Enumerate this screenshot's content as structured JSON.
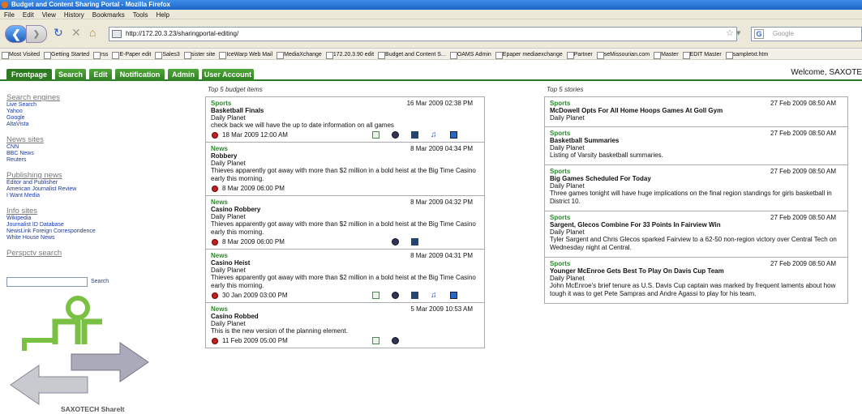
{
  "window": {
    "title": "Budget and Content Sharing Portal - Mozilla Firefox"
  },
  "menu": [
    "File",
    "Edit",
    "View",
    "History",
    "Bookmarks",
    "Tools",
    "Help"
  ],
  "address": {
    "url": "http://172.20.3.23/sharingportal-editing/",
    "search_placeholder": "Google"
  },
  "bookmarks": [
    "Most Visited",
    "Getting Started",
    "rss",
    "E-Paper edit",
    "Sales3",
    "sister site",
    "IceWarp Web Mail",
    "MediaXchange",
    "172.20.3.90 edit",
    "Budget and Content S...",
    "OAMS Admin",
    "Epaper mediaexchange",
    "Partner",
    "seMissourian.com",
    "Master",
    "EDIT Master",
    "sampletxt.htm"
  ],
  "tabs": [
    "Frontpage",
    "Search",
    "Edit",
    "Notification",
    "Admin",
    "User Account"
  ],
  "welcome": "Welcome, SAXOTE",
  "left": {
    "groups": [
      {
        "heading": "Search engines",
        "links": [
          "Live Search",
          "Yahoo",
          "Google",
          "AltaVista"
        ]
      },
      {
        "heading": "News sites",
        "links": [
          "CNN",
          "BBC News",
          "Reuters"
        ]
      },
      {
        "heading": "Publishing news",
        "links": [
          "Editor and Publisher",
          "American Journalist Review",
          "I Want Media"
        ]
      },
      {
        "heading": "Info sites",
        "links": [
          "Wikipedia",
          "Journalist ID Database",
          "NewsLink Foreign Correspondence",
          "White House News"
        ]
      }
    ],
    "search_heading": "Perspctv search",
    "search_button": "Search",
    "logo_text": "SAXOTECH ShareIt"
  },
  "budget": {
    "title": "Top 5 budget items",
    "items": [
      {
        "category": "Sports",
        "timestamp": "16 Mar 2009 02:38 PM",
        "title": "Basketball Finals",
        "source": "Daily Planet",
        "desc": "check back we will have the up to date information on all games",
        "deadline": "18 Mar 2009 12:00 AM",
        "icons": [
          "doc-icon",
          "record-icon",
          "video-icon",
          "audio-icon",
          "image-icon"
        ]
      },
      {
        "category": "News",
        "timestamp": "8 Mar 2009 04:34 PM",
        "title": "Robbery",
        "source": "Daily Planet",
        "desc": "Thieves apparently got away with more than $2 million in a bold heist at the Big Time Casino early this morning.",
        "deadline": "8 Mar 2009 06:00 PM",
        "icons": []
      },
      {
        "category": "News",
        "timestamp": "8 Mar 2009 04:32 PM",
        "title": "Casino Robbery",
        "source": "Daily Planet",
        "desc": "Thieves apparently got away with more than $2 million in a bold heist at the Big Time Casino early this morning.",
        "deadline": "8 Mar 2009 06:00 PM",
        "icons": [
          "record-icon",
          "video-icon"
        ]
      },
      {
        "category": "News",
        "timestamp": "8 Mar 2009 04:31 PM",
        "title": "Casino Heist",
        "source": "Daily Planet",
        "desc": "Thieves apparently got away with more than $2 million in a bold heist at the Big Time Casino early this morning.",
        "deadline": "30 Jan 2009 03:00 PM",
        "icons": [
          "doc-icon",
          "record-icon",
          "video-icon",
          "audio-icon",
          "image-icon"
        ]
      },
      {
        "category": "News",
        "timestamp": "5 Mar 2009 10:53 AM",
        "title": "Casino Robbed",
        "source": "Daily Planet",
        "desc": "This is the new version of the planning element.",
        "deadline": "11 Feb 2009 05:00 PM",
        "icons": [
          "doc-icon",
          "record-icon"
        ]
      }
    ]
  },
  "stories": {
    "title": "Top 5 stories",
    "items": [
      {
        "category": "Sports",
        "timestamp": "27 Feb 2009 08:50 AM",
        "title": "McDowell Opts For All Home Hoops Games At Goll Gym",
        "source": "Daily Planet",
        "desc": ""
      },
      {
        "category": "Sports",
        "timestamp": "27 Feb 2009 08:50 AM",
        "title": "Basketball Summaries",
        "source": "Daily Planet",
        "desc": "Listing of Varsity basketball summaries."
      },
      {
        "category": "Sports",
        "timestamp": "27 Feb 2009 08:50 AM",
        "title": "Big Games Scheduled For Today",
        "source": "Daily Planet",
        "desc": "Three games tonight will have huge implications on the final region standings for girls basketball in District 10."
      },
      {
        "category": "Sports",
        "timestamp": "27 Feb 2009 08:50 AM",
        "title": "Sargent, Glecos Combine For 33 Points In Fairview Win",
        "source": "Daily Planet",
        "desc": "Tyler Sargent and Chris Glecos sparked Fairview to a 62-50 non-region victory over Central Tech on Wednesday night at Central."
      },
      {
        "category": "Sports",
        "timestamp": "27 Feb 2009 08:50 AM",
        "title": "Younger McEnroe Gets Best To Play On Davis Cup Team",
        "source": "Daily Planet",
        "desc": "John McEnroe's brief tenure as U.S. Davis Cup captain was marked by frequent laments about how tough it was to get Pete Sampras and Andre Agassi to play for his team."
      }
    ]
  }
}
